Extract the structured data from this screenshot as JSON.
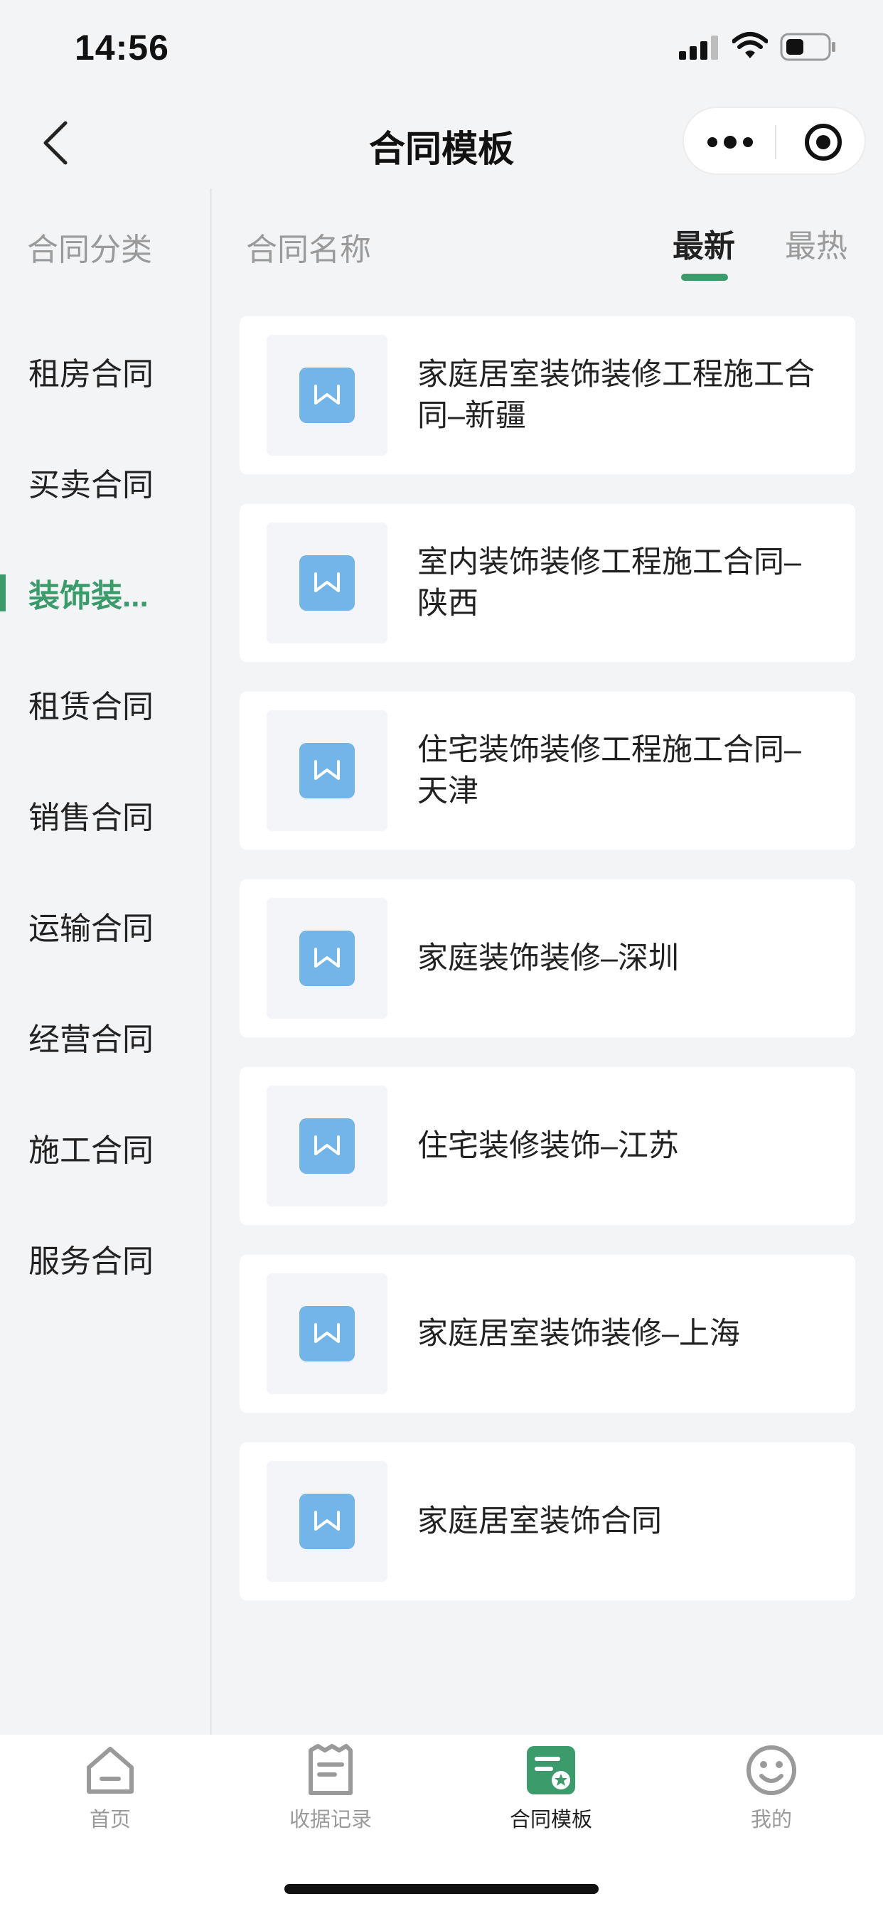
{
  "status_bar": {
    "time": "14:56"
  },
  "nav": {
    "title": "合同模板"
  },
  "sidebar": {
    "header": "合同分类",
    "items": [
      {
        "label": "租房合同"
      },
      {
        "label": "买卖合同"
      },
      {
        "label": "装饰装..."
      },
      {
        "label": "租赁合同"
      },
      {
        "label": "销售合同"
      },
      {
        "label": "运输合同"
      },
      {
        "label": "经营合同"
      },
      {
        "label": "施工合同"
      },
      {
        "label": "服务合同"
      }
    ],
    "active_index": 2
  },
  "list": {
    "header_title": "合同名称",
    "sort_new": "最新",
    "sort_hot": "最热",
    "active_sort": "最新",
    "items": [
      {
        "title": "家庭居室装饰装修工程施工合同–新疆",
        "icon": "word-doc-icon"
      },
      {
        "title": "室内装饰装修工程施工合同–陕西",
        "icon": "word-doc-icon"
      },
      {
        "title": "住宅装饰装修工程施工合同–天津",
        "icon": "word-doc-icon"
      },
      {
        "title": "家庭装饰装修–深圳",
        "icon": "word-doc-icon"
      },
      {
        "title": "住宅装修装饰–江苏",
        "icon": "word-doc-icon"
      },
      {
        "title": "家庭居室装饰装修–上海",
        "icon": "word-doc-icon"
      },
      {
        "title": "家庭居室装饰合同",
        "icon": "word-doc-icon"
      }
    ]
  },
  "tabbar": {
    "items": [
      {
        "label": "首页",
        "icon": "home-icon"
      },
      {
        "label": "收据记录",
        "icon": "receipt-icon"
      },
      {
        "label": "合同模板",
        "icon": "contract-template-icon"
      },
      {
        "label": "我的",
        "icon": "smiley-icon"
      }
    ],
    "active_index": 2
  },
  "colors": {
    "accent": "#3b9b6b",
    "word_icon": "#73b4e9",
    "background": "#f3f4f6",
    "card": "#ffffff"
  }
}
